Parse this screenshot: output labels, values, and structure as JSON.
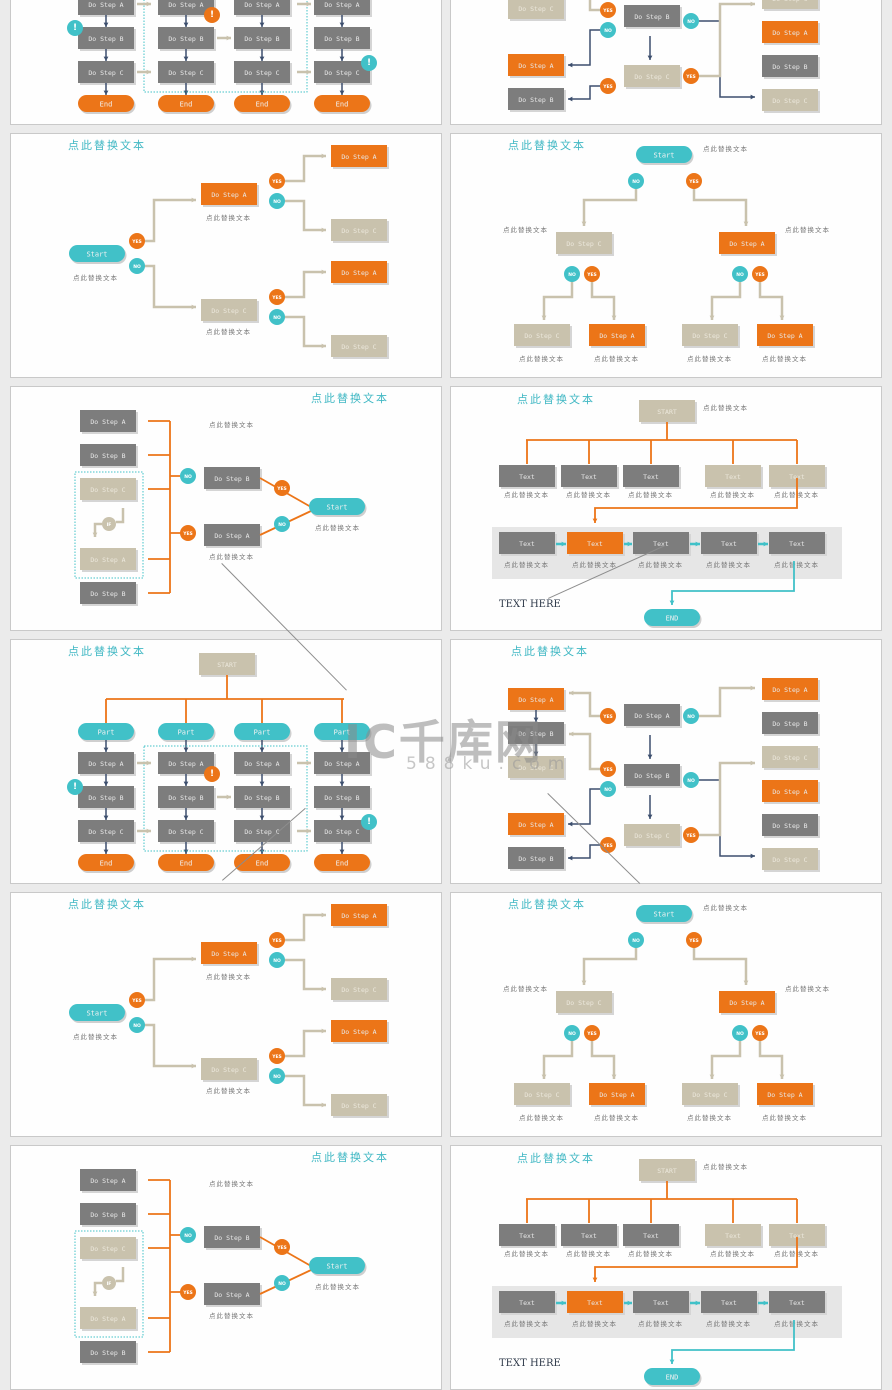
{
  "colors": {
    "orange": "#ec7518",
    "teal": "#41c1c8",
    "gray": "#7d7d7d",
    "beige": "#c9c2ad",
    "navy": "#3d4f6e",
    "title": "#41b8c4",
    "caption": "#777777"
  },
  "labels": {
    "title": "点此替换文本",
    "caption": "点此替换文本",
    "start": "Start",
    "start_caps": "START",
    "end": "End",
    "end_caps": "END",
    "part": "Part",
    "yes": "YES",
    "no": "NO",
    "if": "IF",
    "alert": "!",
    "step_a": "Do Step A",
    "step_b": "Do Step B",
    "step_c": "Do Step C",
    "text": "Text",
    "text_here": "TEXT HERE"
  },
  "watermark": {
    "logo": "IC千库网",
    "site": "588ku.com"
  },
  "slides": [
    {
      "id": "s0",
      "template": "parts-grid",
      "cropTop": true
    },
    {
      "id": "s1",
      "template": "decision-matrix",
      "cropTop": true
    },
    {
      "id": "s2",
      "template": "tree-horizontal"
    },
    {
      "id": "s3",
      "template": "tree-vertical"
    },
    {
      "id": "s4",
      "template": "merge-to-start"
    },
    {
      "id": "s5",
      "template": "org-process"
    },
    {
      "id": "s6",
      "template": "parts-grid"
    },
    {
      "id": "s7",
      "template": "decision-matrix"
    },
    {
      "id": "s8",
      "template": "tree-horizontal"
    },
    {
      "id": "s9",
      "template": "tree-vertical"
    },
    {
      "id": "s10",
      "template": "merge-to-start"
    },
    {
      "id": "s11",
      "template": "org-process"
    }
  ]
}
